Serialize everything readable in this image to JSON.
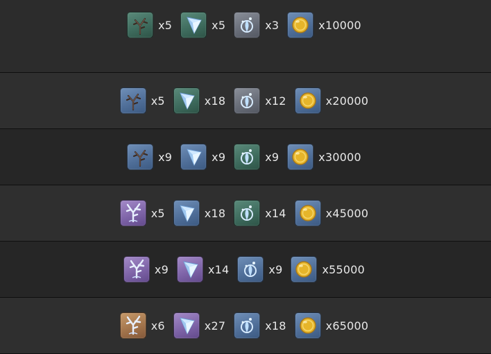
{
  "rows": [
    {
      "items": [
        {
          "icon": "branch-icon",
          "rarity": "green",
          "qty": "x5"
        },
        {
          "icon": "crystal-shard-icon",
          "rarity": "green",
          "qty": "x5"
        },
        {
          "icon": "spirit-essence-icon",
          "rarity": "gray",
          "qty": "x3"
        },
        {
          "icon": "gold-coin-icon",
          "rarity": "blue",
          "qty": "x10000"
        }
      ]
    },
    {
      "items": [
        {
          "icon": "branch-icon",
          "rarity": "blue",
          "qty": "x5"
        },
        {
          "icon": "crystal-shard-icon",
          "rarity": "green",
          "qty": "x18"
        },
        {
          "icon": "spirit-essence-icon",
          "rarity": "gray",
          "qty": "x12"
        },
        {
          "icon": "gold-coin-icon",
          "rarity": "blue",
          "qty": "x20000"
        }
      ]
    },
    {
      "items": [
        {
          "icon": "branch-icon",
          "rarity": "blue",
          "qty": "x9"
        },
        {
          "icon": "crystal-shard-icon",
          "rarity": "blue",
          "qty": "x9"
        },
        {
          "icon": "spirit-essence-icon",
          "rarity": "green",
          "qty": "x9"
        },
        {
          "icon": "gold-coin-icon",
          "rarity": "blue",
          "qty": "x30000"
        }
      ]
    },
    {
      "items": [
        {
          "icon": "coral-icon",
          "rarity": "purple",
          "qty": "x5"
        },
        {
          "icon": "crystal-shard-icon",
          "rarity": "blue",
          "qty": "x18"
        },
        {
          "icon": "spirit-essence-icon",
          "rarity": "green",
          "qty": "x14"
        },
        {
          "icon": "gold-coin-icon",
          "rarity": "blue",
          "qty": "x45000"
        }
      ]
    },
    {
      "items": [
        {
          "icon": "coral-icon",
          "rarity": "purple",
          "qty": "x9"
        },
        {
          "icon": "crystal-shard-icon",
          "rarity": "purple",
          "qty": "x14"
        },
        {
          "icon": "spirit-essence-icon",
          "rarity": "blue",
          "qty": "x9"
        },
        {
          "icon": "gold-coin-icon",
          "rarity": "blue",
          "qty": "x55000"
        }
      ]
    },
    {
      "items": [
        {
          "icon": "coral-icon",
          "rarity": "gold",
          "qty": "x6"
        },
        {
          "icon": "crystal-shard-icon",
          "rarity": "purple",
          "qty": "x27"
        },
        {
          "icon": "spirit-essence-icon",
          "rarity": "blue",
          "qty": "x18"
        },
        {
          "icon": "gold-coin-icon",
          "rarity": "blue",
          "qty": "x65000"
        }
      ]
    }
  ]
}
